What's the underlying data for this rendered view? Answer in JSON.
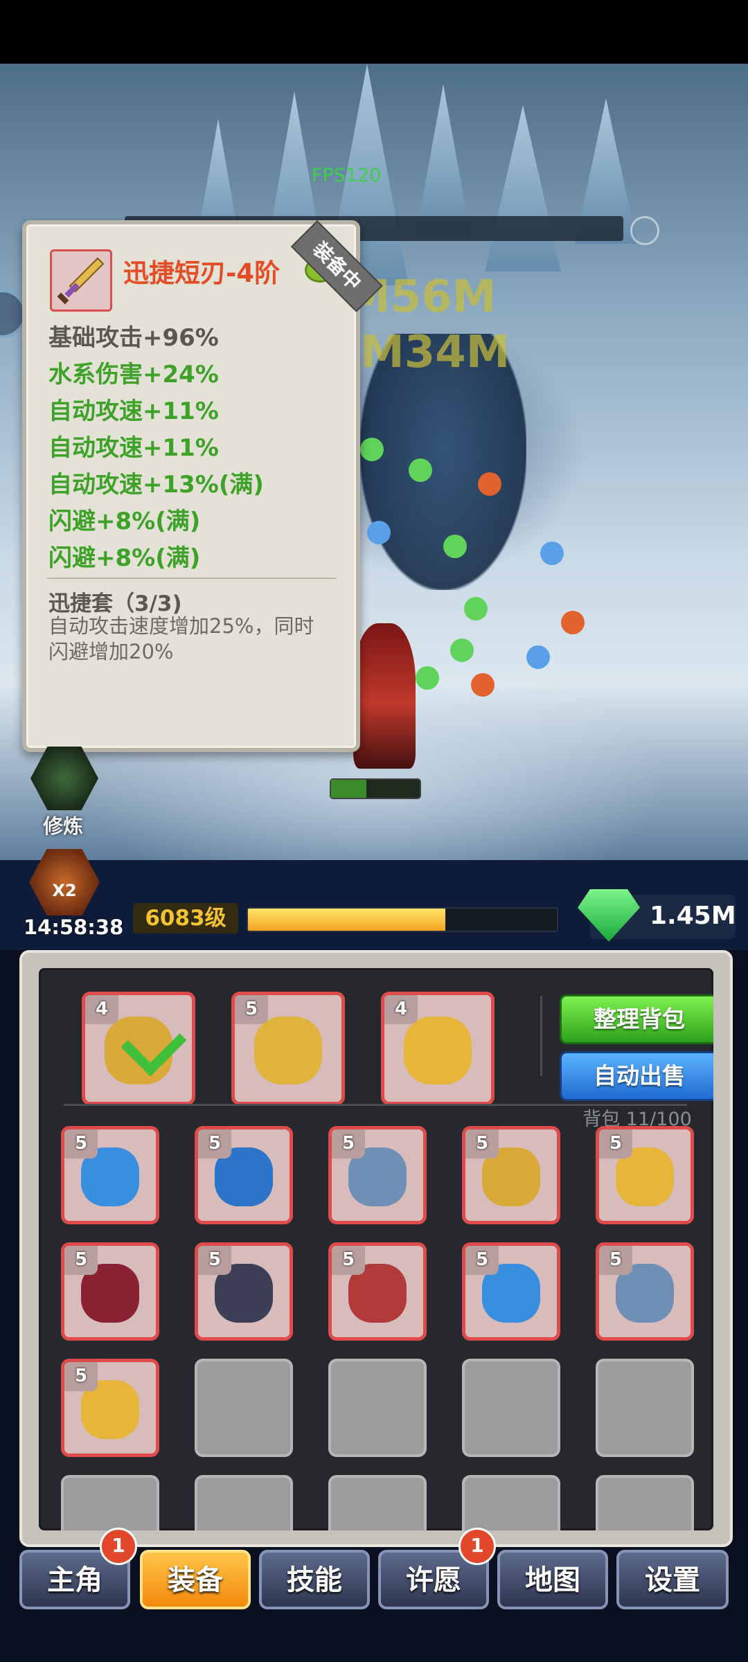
{
  "hud": {
    "fps": "FPS120"
  },
  "tooltip": {
    "item_name": "迅捷短刃-4阶",
    "equipped_badge": "装备中",
    "stats": [
      {
        "text": "基础攻击+96%",
        "kind": "base"
      },
      {
        "text": "水系伤害+24%",
        "kind": "bonus"
      },
      {
        "text": "自动攻速+11%",
        "kind": "bonus"
      },
      {
        "text": "自动攻速+11%",
        "kind": "bonus"
      },
      {
        "text": "自动攻速+13%(满)",
        "kind": "bonus"
      },
      {
        "text": "闪避+8%(满)",
        "kind": "bonus"
      },
      {
        "text": "闪避+8%(满)",
        "kind": "bonus"
      }
    ],
    "set_title": "迅捷套（3/3)",
    "set_desc": "自动攻击速度增加25%，同时闪避增加20%"
  },
  "side": {
    "skill_label": "修炼",
    "x2_label": "X2",
    "timer": "14:58:38"
  },
  "status": {
    "level": "6083级",
    "xp_fraction": 0.64,
    "gems": "1.45M"
  },
  "inventory": {
    "equipped": [
      {
        "level": "4",
        "icon": "dagger-icon",
        "color": "#d9a93a",
        "equipped_check": true
      },
      {
        "level": "5",
        "icon": "golden-armor-icon",
        "color": "#e0b43c",
        "equipped_check": false
      },
      {
        "level": "4",
        "icon": "crown-icon",
        "color": "#e7b53a",
        "equipped_check": false
      }
    ],
    "sort_button": "整理背包",
    "auto_sell_button": "自动出售",
    "bag_count": "背包 11/100",
    "items": [
      {
        "level": "5",
        "icon": "ice-axe-icon",
        "color": "#3a8ee0"
      },
      {
        "level": "5",
        "icon": "blue-armor-icon",
        "color": "#2d75c9"
      },
      {
        "level": "5",
        "icon": "sapphire-ring-icon",
        "color": "#6f8fb5"
      },
      {
        "level": "5",
        "icon": "dagger-icon",
        "color": "#d9a93a"
      },
      {
        "level": "5",
        "icon": "crown-icon",
        "color": "#e7b53a"
      },
      {
        "level": "5",
        "icon": "dark-staff-icon",
        "color": "#8a2133"
      },
      {
        "level": "5",
        "icon": "dark-helmet-icon",
        "color": "#3c3f56"
      },
      {
        "level": "5",
        "icon": "skull-armor-icon",
        "color": "#b23a3a"
      },
      {
        "level": "5",
        "icon": "ice-axe-icon",
        "color": "#3a8ee0"
      },
      {
        "level": "5",
        "icon": "sapphire-ring-icon",
        "color": "#6f8fb5"
      },
      {
        "level": "5",
        "icon": "crown-icon",
        "color": "#e7b53a"
      }
    ]
  },
  "nav": [
    {
      "label": "主角",
      "badge": "1"
    },
    {
      "label": "装备",
      "active": true
    },
    {
      "label": "技能"
    },
    {
      "label": "许愿",
      "badge": "1"
    },
    {
      "label": "地图"
    },
    {
      "label": "设置"
    }
  ]
}
